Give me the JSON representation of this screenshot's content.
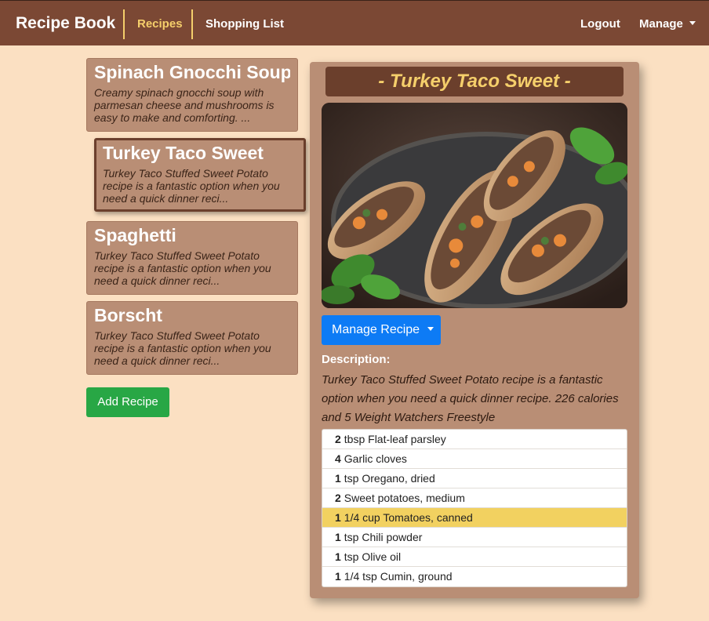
{
  "nav": {
    "brand": "Recipe Book",
    "links": [
      "Recipes",
      "Shopping List"
    ],
    "right": {
      "logout": "Logout",
      "manage": "Manage"
    }
  },
  "recipes": [
    {
      "title": "Spinach Gnocchi Soup",
      "desc": "Creamy spinach gnocchi soup with parmesan cheese and mushrooms is easy to make and comforting. ..."
    },
    {
      "title": "Turkey Taco Sweet",
      "desc": "Turkey Taco Stuffed Sweet Potato recipe is a fantastic option when you need a quick dinner reci..."
    },
    {
      "title": "Spaghetti",
      "desc": "Turkey Taco Stuffed Sweet Potato recipe is a fantastic option when you need a quick dinner reci..."
    },
    {
      "title": "Borscht",
      "desc": "Turkey Taco Stuffed Sweet Potato recipe is a fantastic option when you need a quick dinner reci..."
    }
  ],
  "add_button": "Add Recipe",
  "detail": {
    "title": "- Turkey Taco Sweet -",
    "manage_button": "Manage Recipe",
    "description_label": "Description:",
    "description": "Turkey Taco Stuffed Sweet Potato recipe is a fantastic option when you need a quick dinner recipe. 226 calories and 5 Weight Watchers Freestyle",
    "ingredients": [
      {
        "qty": "2",
        "name": "tbsp Flat-leaf parsley"
      },
      {
        "qty": "4",
        "name": "Garlic cloves"
      },
      {
        "qty": "1",
        "name": "tsp Oregano, dried"
      },
      {
        "qty": "2",
        "name": "Sweet potatoes, medium"
      },
      {
        "qty": "1",
        "name": "1/4 cup Tomatoes, canned"
      },
      {
        "qty": "1",
        "name": "tsp Chili powder"
      },
      {
        "qty": "1",
        "name": "tsp Olive oil"
      },
      {
        "qty": "1",
        "name": "1/4 tsp Cumin, ground"
      }
    ],
    "highlighted_index": 4
  },
  "colors": {
    "navbar": "#7b4834",
    "background": "#fbe0c2",
    "card": "#b98e75",
    "accent": "#f5cf6b",
    "primary": "#0d7bf5",
    "success": "#28a745"
  }
}
